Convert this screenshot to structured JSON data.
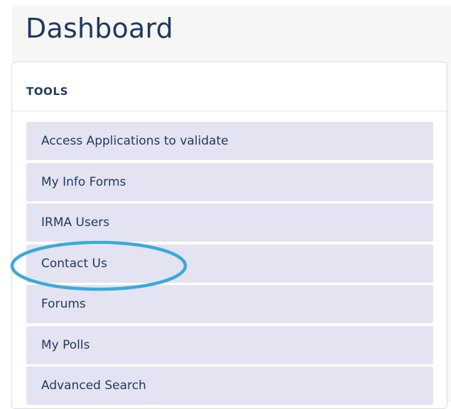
{
  "header": {
    "title": "Dashboard"
  },
  "tools": {
    "title": "TOOLS",
    "items": [
      {
        "label": "Access Applications to validate"
      },
      {
        "label": "My Info Forms"
      },
      {
        "label": "IRMA Users"
      },
      {
        "label": "Contact Us"
      },
      {
        "label": "Forums"
      },
      {
        "label": "My Polls"
      },
      {
        "label": "Advanced Search"
      }
    ]
  },
  "colors": {
    "title_text": "#1d3a5f",
    "item_background": "#e4e3f1",
    "highlight_ellipse": "#3ba9dc"
  }
}
